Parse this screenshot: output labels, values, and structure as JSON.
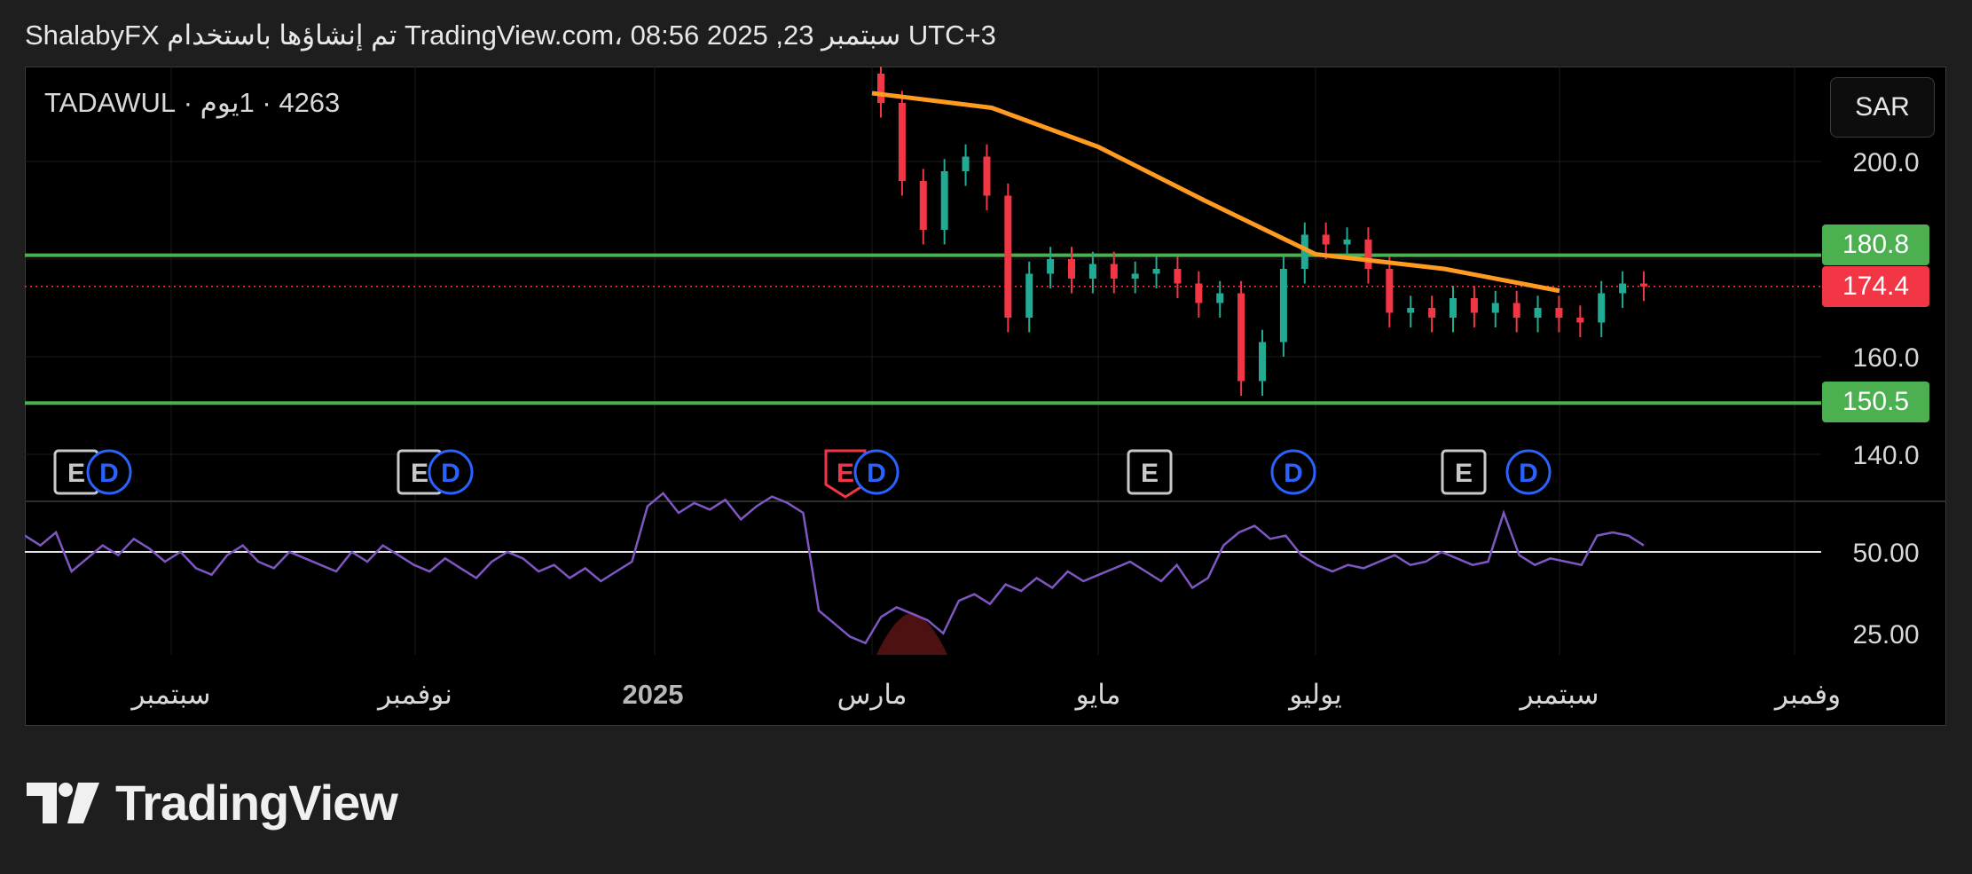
{
  "header": {
    "text": "ShalabyFX تم إنشاؤها باستخدام TradingView.com، 08:56 2025 ,23 سبتمبر UTC+3"
  },
  "symbol": {
    "label": "4263 · 1يوم · TADAWUL"
  },
  "currency_button": "SAR",
  "footer": {
    "brand": "TradingView"
  },
  "colors": {
    "background": "#000000",
    "up_candle": "#22ab94",
    "down_candle": "#f23645",
    "moving_average": "#ff9b20",
    "horizontal_levels": "#4caf50",
    "rsi_line": "#7e57c2",
    "last_price": "#f23645"
  },
  "chart_data": [
    {
      "type": "candlestick",
      "title": "",
      "ylim": [
        128,
        214
      ],
      "y_ticks": [
        "200.0",
        "160.0",
        "140.0"
      ],
      "x_tick_labels": [
        "سبتمبر",
        "نوفمبر",
        "2025",
        "مارس",
        "مايو",
        "يوليو",
        "سبتمبر",
        "وفمبر"
      ],
      "horizontal_levels": [
        {
          "value": 180.8,
          "label": "180.8"
        },
        {
          "value": 150.5,
          "label": "150.5"
        }
      ],
      "last_price": {
        "value": 174.4,
        "label": "174.4"
      },
      "events": [
        {
          "type": "E",
          "period": "2024-08"
        },
        {
          "type": "D",
          "period": "2024-08"
        },
        {
          "type": "E",
          "period": "2024-10"
        },
        {
          "type": "D",
          "period": "2024-10"
        },
        {
          "type": "E",
          "period": "2025-02",
          "highlighted": true
        },
        {
          "type": "D",
          "period": "2025-02"
        },
        {
          "type": "E",
          "period": "2025-05"
        },
        {
          "type": "D",
          "period": "2025-06"
        },
        {
          "type": "E",
          "period": "2025-08"
        },
        {
          "type": "D",
          "period": "2025-08"
        }
      ],
      "moving_average": {
        "name": "",
        "points": [
          {
            "month": "2025-03",
            "value": 214
          },
          {
            "month": "2025-04",
            "value": 211
          },
          {
            "month": "2025-05",
            "value": 203
          },
          {
            "month": "2025-06",
            "value": 192
          },
          {
            "month": "2025-07",
            "value": 181
          },
          {
            "month": "2025-08",
            "value": 178
          },
          {
            "month": "2025-09",
            "value": 173.5
          }
        ]
      },
      "price_series": [
        {
          "month": "2025-02",
          "close": 212
        },
        {
          "month": "2025-02",
          "close": 196
        },
        {
          "month": "2025-03",
          "close": 186
        },
        {
          "month": "2025-03",
          "close": 198
        },
        {
          "month": "2025-03",
          "close": 201
        },
        {
          "month": "2025-03",
          "close": 193
        },
        {
          "month": "2025-04",
          "close": 168
        },
        {
          "month": "2025-04",
          "close": 177
        },
        {
          "month": "2025-04",
          "close": 180
        },
        {
          "month": "2025-04",
          "close": 176
        },
        {
          "month": "2025-05",
          "close": 179
        },
        {
          "month": "2025-05",
          "close": 176
        },
        {
          "month": "2025-05",
          "close": 177
        },
        {
          "month": "2025-05",
          "close": 178
        },
        {
          "month": "2025-05",
          "close": 175
        },
        {
          "month": "2025-06",
          "close": 171
        },
        {
          "month": "2025-06",
          "close": 173
        },
        {
          "month": "2025-06",
          "close": 155
        },
        {
          "month": "2025-06",
          "close": 163
        },
        {
          "month": "2025-06",
          "close": 178
        },
        {
          "month": "2025-07",
          "close": 185
        },
        {
          "month": "2025-07",
          "close": 183
        },
        {
          "month": "2025-07",
          "close": 184
        },
        {
          "month": "2025-07",
          "close": 178
        },
        {
          "month": "2025-07",
          "close": 169
        },
        {
          "month": "2025-08",
          "close": 170
        },
        {
          "month": "2025-08",
          "close": 168
        },
        {
          "month": "2025-08",
          "close": 172
        },
        {
          "month": "2025-08",
          "close": 169
        },
        {
          "month": "2025-08",
          "close": 171
        },
        {
          "month": "2025-08",
          "close": 168
        },
        {
          "month": "2025-09",
          "close": 170
        },
        {
          "month": "2025-09",
          "close": 168
        },
        {
          "month": "2025-09",
          "close": 167
        },
        {
          "month": "2025-09",
          "close": 173
        },
        {
          "month": "2025-09",
          "close": 175
        },
        {
          "month": "2025-09",
          "close": 174.4
        }
      ]
    },
    {
      "type": "line",
      "title": "",
      "ylim": [
        20,
        80
      ],
      "y_ticks": [
        "50.00",
        "25.00"
      ],
      "reference_line": 50,
      "series": [
        {
          "name": "",
          "values": [
            55,
            52,
            56,
            44,
            48,
            52,
            49,
            54,
            51,
            47,
            50,
            45,
            43,
            49,
            52,
            47,
            45,
            50,
            48,
            46,
            44,
            50,
            47,
            52,
            49,
            46,
            44,
            48,
            45,
            42,
            47,
            50,
            48,
            44,
            46,
            42,
            45,
            41,
            44,
            47,
            64,
            68,
            62,
            65,
            63,
            66,
            60,
            64,
            67,
            65,
            62,
            32,
            28,
            24,
            22,
            30,
            33,
            31,
            29,
            25,
            35,
            37,
            34,
            40,
            38,
            42,
            39,
            44,
            41,
            43,
            45,
            47,
            44,
            41,
            46,
            39,
            42,
            52,
            56,
            58,
            54,
            55,
            49,
            46,
            44,
            46,
            45,
            47,
            49,
            46,
            47,
            50,
            48,
            46,
            47,
            62,
            49,
            46,
            48,
            47,
            46,
            55,
            56,
            55,
            52
          ]
        }
      ]
    }
  ]
}
